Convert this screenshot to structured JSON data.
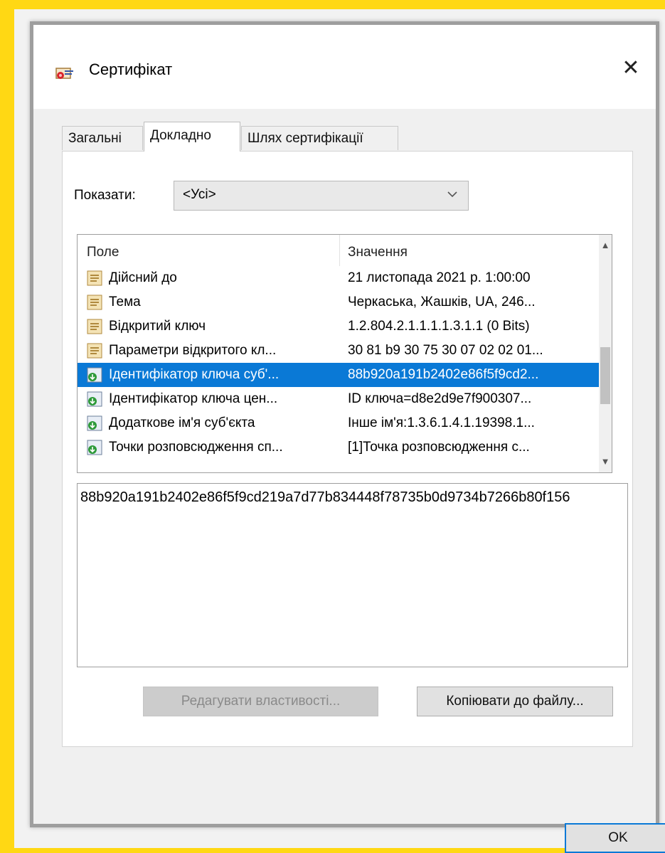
{
  "window": {
    "title": "Сертифікат",
    "close_symbol": "✕"
  },
  "tabs": [
    {
      "label": "Загальні",
      "active": false
    },
    {
      "label": "Докладно",
      "active": true
    },
    {
      "label": "Шлях сертифікації",
      "active": false
    }
  ],
  "show": {
    "label": "Показати:",
    "selected": "<Усі>"
  },
  "list": {
    "columns": [
      "Поле",
      "Значення"
    ],
    "rows": [
      {
        "field": "Дійсний до",
        "value": "21 листопада 2021 р. 1:00:00",
        "icon": "certificate-field-icon",
        "selected": false
      },
      {
        "field": "Тема",
        "value": "Черкаська, Жашків, UA, 246...",
        "icon": "certificate-field-icon",
        "selected": false
      },
      {
        "field": "Відкритий ключ",
        "value": "1.2.804.2.1.1.1.1.3.1.1 (0 Bits)",
        "icon": "certificate-field-icon",
        "selected": false
      },
      {
        "field": "Параметри відкритого кл...",
        "value": "30 81 b9 30 75 30 07 02 02 01...",
        "icon": "certificate-field-icon",
        "selected": false
      },
      {
        "field": "Ідентифікатор ключа суб'...",
        "value": "88b920a191b2402e86f5f9cd2...",
        "icon": "extension-icon",
        "selected": true
      },
      {
        "field": "Ідентифікатор ключа цен...",
        "value": "ID ключа=d8e2d9e7f900307...",
        "icon": "extension-icon",
        "selected": false
      },
      {
        "field": "Додаткове ім'я суб'єкта",
        "value": "Інше ім'я:1.3.6.1.4.1.19398.1...",
        "icon": "extension-icon",
        "selected": false
      },
      {
        "field": "Точки розповсюдження сп...",
        "value": "[1]Точка розповсюдження с...",
        "icon": "extension-icon",
        "selected": false
      }
    ]
  },
  "value_box": {
    "text": "88b920a191b2402e86f5f9cd219a7d77b834448f78735b0d9734b7266b80f156"
  },
  "buttons": {
    "edit": "Редагувати властивості...",
    "copy": "Копіювати до файлу...",
    "ok": "OK"
  },
  "colors": {
    "background": "#ffd814",
    "selection": "#0a79d6"
  }
}
